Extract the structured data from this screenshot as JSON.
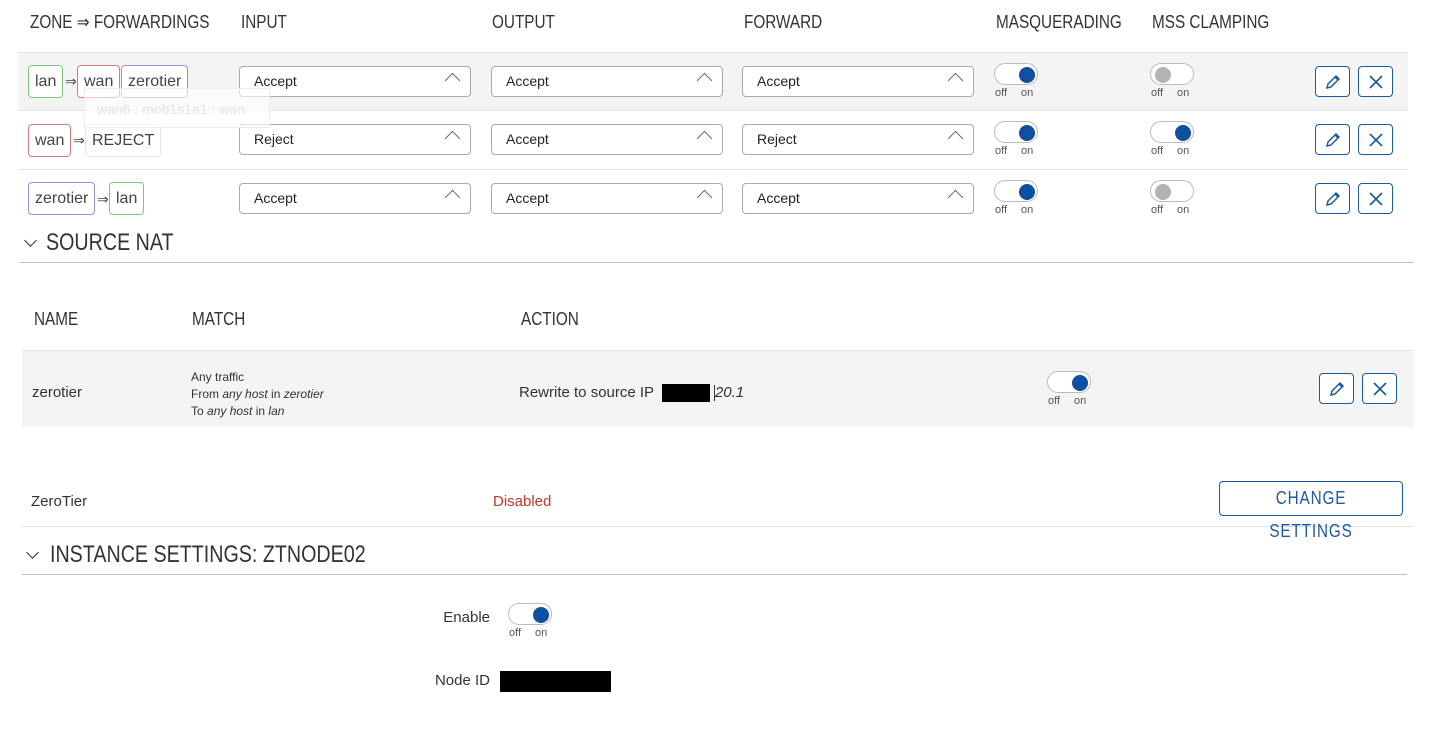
{
  "zones": {
    "headers": [
      "ZONE ⇒ FORWARDINGS",
      "INPUT",
      "OUTPUT",
      "FORWARD",
      "MASQUERADING",
      "MSS CLAMPING"
    ],
    "toggle_off_label": "off",
    "toggle_on_label": "on",
    "tooltip_text": "wan6 : mob1s1a1 : wan",
    "rows": [
      {
        "zone": "lan",
        "zone_color": "#7ec87e",
        "arrow": "⇒",
        "forwardings": [
          "wan",
          "zerotier"
        ],
        "input": "Accept",
        "output": "Accept",
        "forward": "Accept",
        "masquerading": false,
        "mss_clamping": false
      },
      {
        "zone": "wan",
        "zone_color": "#d97a7a",
        "arrow": "⇒",
        "forwardings": [
          "REJECT"
        ],
        "input": "Reject",
        "output": "Accept",
        "forward": "Reject",
        "masquerading": true,
        "mss_clamping": true
      },
      {
        "zone": "zerotier",
        "zone_color": "#9b8fd9",
        "arrow": "⇒",
        "forwardings": [
          "lan"
        ],
        "input": "Accept",
        "output": "Accept",
        "forward": "Accept",
        "masquerading": true,
        "mss_clamping": false
      }
    ]
  },
  "source_nat": {
    "title": "SOURCE NAT",
    "headers": {
      "name": "NAME",
      "match": "MATCH",
      "action": "ACTION"
    },
    "rows": [
      {
        "name": "zerotier",
        "match_line1": "Any traffic",
        "match_from_prefix": "From ",
        "match_from_host": "any host",
        "match_from_in": " in ",
        "match_from_zone": "zerotier",
        "match_to_prefix": "To ",
        "match_to_host": "any host",
        "match_to_in": " in ",
        "match_to_zone": "lan",
        "action_text": "Rewrite to source IP",
        "action_ip_suffix": "20.1",
        "enabled": true
      }
    ]
  },
  "zerotier": {
    "name": "ZeroTier",
    "status": "Disabled",
    "status_color": "#c0392b",
    "change_button": "CHANGE SETTINGS"
  },
  "instance": {
    "title": "INSTANCE SETTINGS: ZTNODE02",
    "enable_label": "Enable",
    "enabled": true,
    "node_id_label": "Node ID"
  },
  "colors": {
    "accent": "#0e4fa0",
    "button_border": "#1b5a9e"
  }
}
